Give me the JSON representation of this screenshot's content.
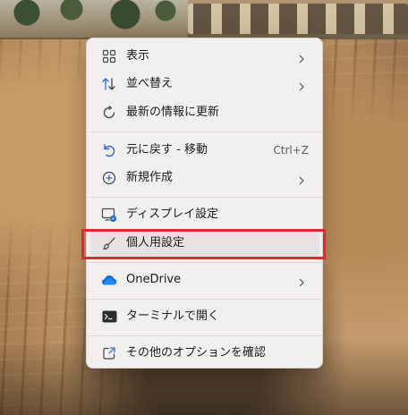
{
  "menu": {
    "items": [
      {
        "id": "view",
        "label": "表示",
        "icon": "grid-icon",
        "has_submenu": true
      },
      {
        "id": "sort",
        "label": "並べ替え",
        "icon": "sort-arrows-icon",
        "has_submenu": true
      },
      {
        "id": "refresh",
        "label": "最新の情報に更新",
        "icon": "refresh-icon",
        "has_submenu": false
      },
      {
        "id": "undo",
        "label": "元に戻す - 移動",
        "icon": "undo-icon",
        "shortcut": "Ctrl+Z",
        "has_submenu": false
      },
      {
        "id": "new",
        "label": "新規作成",
        "icon": "plus-circle-icon",
        "has_submenu": true
      },
      {
        "id": "display",
        "label": "ディスプレイ設定",
        "icon": "display-settings-icon",
        "has_submenu": false
      },
      {
        "id": "personalize",
        "label": "個人用設定",
        "icon": "brush-icon",
        "has_submenu": false
      },
      {
        "id": "onedrive",
        "label": "OneDrive",
        "icon": "cloud-icon",
        "has_submenu": true
      },
      {
        "id": "terminal",
        "label": "ターミナルで開く",
        "icon": "terminal-icon",
        "has_submenu": false
      },
      {
        "id": "more",
        "label": "その他のオプションを確認",
        "icon": "external-open-icon",
        "has_submenu": false
      }
    ]
  },
  "colors": {
    "menu_background": "#f2efef",
    "hover": "#e6e2e2",
    "accent_blue": "#2a6ad8",
    "onedrive_blue": "#0d71d6",
    "highlight_box": "#e3262f"
  }
}
